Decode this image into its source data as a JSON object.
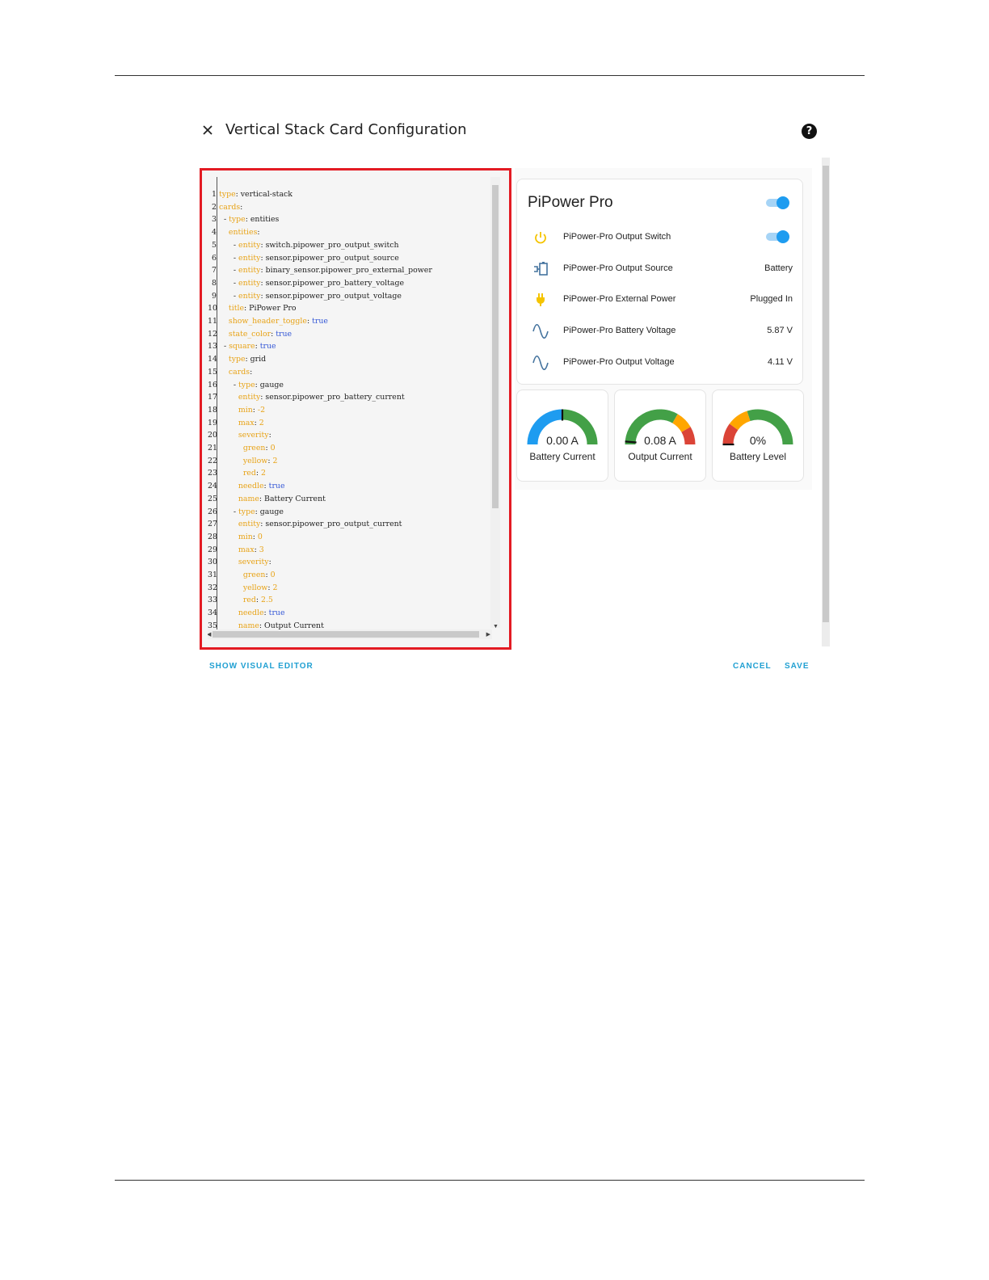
{
  "dialog": {
    "title": "Vertical Stack Card Configuration",
    "close_icon": "close-icon",
    "help_icon": "help-icon",
    "help_glyph": "?"
  },
  "editor": {
    "lines": [
      {
        "n": "1",
        "parts": [
          {
            "t": "type",
            "c": "k"
          },
          {
            "t": ": vertical-stack",
            "c": ""
          }
        ]
      },
      {
        "n": "2",
        "parts": [
          {
            "t": "cards",
            "c": "k"
          },
          {
            "t": ":",
            "c": ""
          }
        ]
      },
      {
        "n": "3",
        "parts": [
          {
            "t": "  - ",
            "c": ""
          },
          {
            "t": "type",
            "c": "k"
          },
          {
            "t": ": entities",
            "c": ""
          }
        ]
      },
      {
        "n": "4",
        "parts": [
          {
            "t": "    ",
            "c": ""
          },
          {
            "t": "entities",
            "c": "k"
          },
          {
            "t": ":",
            "c": ""
          }
        ]
      },
      {
        "n": "5",
        "parts": [
          {
            "t": "      - ",
            "c": ""
          },
          {
            "t": "entity",
            "c": "k"
          },
          {
            "t": ": switch.pipower_pro_output_switch",
            "c": ""
          }
        ]
      },
      {
        "n": "6",
        "parts": [
          {
            "t": "      - ",
            "c": ""
          },
          {
            "t": "entity",
            "c": "k"
          },
          {
            "t": ": sensor.pipower_pro_output_source",
            "c": ""
          }
        ]
      },
      {
        "n": "7",
        "parts": [
          {
            "t": "      - ",
            "c": ""
          },
          {
            "t": "entity",
            "c": "k"
          },
          {
            "t": ": binary_sensor.pipower_pro_external_power",
            "c": ""
          }
        ]
      },
      {
        "n": "8",
        "parts": [
          {
            "t": "      - ",
            "c": ""
          },
          {
            "t": "entity",
            "c": "k"
          },
          {
            "t": ": sensor.pipower_pro_battery_voltage",
            "c": ""
          }
        ]
      },
      {
        "n": "9",
        "parts": [
          {
            "t": "      - ",
            "c": ""
          },
          {
            "t": "entity",
            "c": "k"
          },
          {
            "t": ": sensor.pipower_pro_output_voltage",
            "c": ""
          }
        ]
      },
      {
        "n": "10",
        "parts": [
          {
            "t": "    ",
            "c": ""
          },
          {
            "t": "title",
            "c": "k"
          },
          {
            "t": ": PiPower Pro",
            "c": ""
          }
        ]
      },
      {
        "n": "11",
        "parts": [
          {
            "t": "    ",
            "c": ""
          },
          {
            "t": "show_header_toggle",
            "c": "k"
          },
          {
            "t": ": ",
            "c": ""
          },
          {
            "t": "true",
            "c": "b"
          }
        ]
      },
      {
        "n": "12",
        "parts": [
          {
            "t": "    ",
            "c": ""
          },
          {
            "t": "state_color",
            "c": "k"
          },
          {
            "t": ": ",
            "c": ""
          },
          {
            "t": "true",
            "c": "b"
          }
        ]
      },
      {
        "n": "13",
        "parts": [
          {
            "t": "  - ",
            "c": ""
          },
          {
            "t": "square",
            "c": "k"
          },
          {
            "t": ": ",
            "c": ""
          },
          {
            "t": "true",
            "c": "b"
          }
        ]
      },
      {
        "n": "14",
        "parts": [
          {
            "t": "    ",
            "c": ""
          },
          {
            "t": "type",
            "c": "k"
          },
          {
            "t": ": grid",
            "c": ""
          }
        ]
      },
      {
        "n": "15",
        "parts": [
          {
            "t": "    ",
            "c": ""
          },
          {
            "t": "cards",
            "c": "k"
          },
          {
            "t": ":",
            "c": ""
          }
        ]
      },
      {
        "n": "16",
        "parts": [
          {
            "t": "      - ",
            "c": ""
          },
          {
            "t": "type",
            "c": "k"
          },
          {
            "t": ": gauge",
            "c": ""
          }
        ]
      },
      {
        "n": "17",
        "parts": [
          {
            "t": "        ",
            "c": ""
          },
          {
            "t": "entity",
            "c": "k"
          },
          {
            "t": ": sensor.pipower_pro_battery_current",
            "c": ""
          }
        ]
      },
      {
        "n": "18",
        "parts": [
          {
            "t": "        ",
            "c": ""
          },
          {
            "t": "min",
            "c": "k"
          },
          {
            "t": ": ",
            "c": ""
          },
          {
            "t": "-2",
            "c": "k"
          }
        ]
      },
      {
        "n": "19",
        "parts": [
          {
            "t": "        ",
            "c": ""
          },
          {
            "t": "max",
            "c": "k"
          },
          {
            "t": ": ",
            "c": ""
          },
          {
            "t": "2",
            "c": "k"
          }
        ]
      },
      {
        "n": "20",
        "parts": [
          {
            "t": "        ",
            "c": ""
          },
          {
            "t": "severity",
            "c": "k"
          },
          {
            "t": ":",
            "c": ""
          }
        ]
      },
      {
        "n": "21",
        "parts": [
          {
            "t": "          ",
            "c": ""
          },
          {
            "t": "green",
            "c": "k"
          },
          {
            "t": ": ",
            "c": ""
          },
          {
            "t": "0",
            "c": "k"
          }
        ]
      },
      {
        "n": "22",
        "parts": [
          {
            "t": "          ",
            "c": ""
          },
          {
            "t": "yellow",
            "c": "k"
          },
          {
            "t": ": ",
            "c": ""
          },
          {
            "t": "2",
            "c": "k"
          }
        ]
      },
      {
        "n": "23",
        "parts": [
          {
            "t": "          ",
            "c": ""
          },
          {
            "t": "red",
            "c": "k"
          },
          {
            "t": ": ",
            "c": ""
          },
          {
            "t": "2",
            "c": "k"
          }
        ]
      },
      {
        "n": "24",
        "parts": [
          {
            "t": "        ",
            "c": ""
          },
          {
            "t": "needle",
            "c": "k"
          },
          {
            "t": ": ",
            "c": ""
          },
          {
            "t": "true",
            "c": "b"
          }
        ]
      },
      {
        "n": "25",
        "parts": [
          {
            "t": "        ",
            "c": ""
          },
          {
            "t": "name",
            "c": "k"
          },
          {
            "t": ": Battery Current",
            "c": ""
          }
        ]
      },
      {
        "n": "26",
        "parts": [
          {
            "t": "      - ",
            "c": ""
          },
          {
            "t": "type",
            "c": "k"
          },
          {
            "t": ": gauge",
            "c": ""
          }
        ]
      },
      {
        "n": "27",
        "parts": [
          {
            "t": "        ",
            "c": ""
          },
          {
            "t": "entity",
            "c": "k"
          },
          {
            "t": ": sensor.pipower_pro_output_current",
            "c": ""
          }
        ]
      },
      {
        "n": "28",
        "parts": [
          {
            "t": "        ",
            "c": ""
          },
          {
            "t": "min",
            "c": "k"
          },
          {
            "t": ": ",
            "c": ""
          },
          {
            "t": "0",
            "c": "k"
          }
        ]
      },
      {
        "n": "29",
        "parts": [
          {
            "t": "        ",
            "c": ""
          },
          {
            "t": "max",
            "c": "k"
          },
          {
            "t": ": ",
            "c": ""
          },
          {
            "t": "3",
            "c": "k"
          }
        ]
      },
      {
        "n": "30",
        "parts": [
          {
            "t": "        ",
            "c": ""
          },
          {
            "t": "severity",
            "c": "k"
          },
          {
            "t": ":",
            "c": ""
          }
        ]
      },
      {
        "n": "31",
        "parts": [
          {
            "t": "          ",
            "c": ""
          },
          {
            "t": "green",
            "c": "k"
          },
          {
            "t": ": ",
            "c": ""
          },
          {
            "t": "0",
            "c": "k"
          }
        ]
      },
      {
        "n": "32",
        "parts": [
          {
            "t": "          ",
            "c": ""
          },
          {
            "t": "yellow",
            "c": "k"
          },
          {
            "t": ": ",
            "c": ""
          },
          {
            "t": "2",
            "c": "k"
          }
        ]
      },
      {
        "n": "33",
        "parts": [
          {
            "t": "          ",
            "c": ""
          },
          {
            "t": "red",
            "c": "k"
          },
          {
            "t": ": ",
            "c": ""
          },
          {
            "t": "2.5",
            "c": "k"
          }
        ]
      },
      {
        "n": "34",
        "parts": [
          {
            "t": "        ",
            "c": ""
          },
          {
            "t": "needle",
            "c": "k"
          },
          {
            "t": ": ",
            "c": ""
          },
          {
            "t": "true",
            "c": "b"
          }
        ]
      },
      {
        "n": "35",
        "parts": [
          {
            "t": "        ",
            "c": ""
          },
          {
            "t": "name",
            "c": "k"
          },
          {
            "t": ": Output Current",
            "c": ""
          }
        ]
      }
    ]
  },
  "entities_card": {
    "title": "PiPower Pro",
    "header_toggle_on": true,
    "rows": [
      {
        "icon": "power-icon",
        "label": "PiPower-Pro Output Switch",
        "kind": "toggle",
        "value": ""
      },
      {
        "icon": "battery-plug-icon",
        "label": "PiPower-Pro Output Source",
        "kind": "text",
        "value": "Battery"
      },
      {
        "icon": "plug-icon",
        "label": "PiPower-Pro External Power",
        "kind": "text",
        "value": "Plugged In"
      },
      {
        "icon": "sine-wave-icon",
        "label": "PiPower-Pro Battery Voltage",
        "kind": "text",
        "value": "5.87 V"
      },
      {
        "icon": "sine-wave-icon",
        "label": "PiPower-Pro Output Voltage",
        "kind": "text",
        "value": "4.11 V"
      }
    ]
  },
  "gauges": [
    {
      "name": "Battery Current",
      "value_text": "0.00 A",
      "value": 0.0,
      "min": -2,
      "max": 2,
      "fill_color": "#1e9cf0",
      "needle": true,
      "segments": []
    },
    {
      "name": "Output Current",
      "value_text": "0.08 A",
      "value": 0.08,
      "min": 0,
      "max": 3,
      "needle": true,
      "segments": [
        {
          "from": 0,
          "to": 2,
          "color": "#43a047"
        },
        {
          "from": 2,
          "to": 2.5,
          "color": "#ffa600"
        },
        {
          "from": 2.5,
          "to": 3,
          "color": "#db4437"
        }
      ]
    },
    {
      "name": "Battery Level",
      "value_text": "0%",
      "value": 0,
      "min": 0,
      "max": 100,
      "needle": true,
      "segments": [
        {
          "from": 0,
          "to": 20,
          "color": "#db4437"
        },
        {
          "from": 20,
          "to": 40,
          "color": "#ffa600"
        },
        {
          "from": 40,
          "to": 100,
          "color": "#43a047"
        }
      ]
    }
  ],
  "actions": {
    "show_visual_editor": "SHOW VISUAL EDITOR",
    "cancel": "CANCEL",
    "save": "SAVE"
  },
  "colors": {
    "accent": "#21a0d2",
    "highlight_border": "#e31b23",
    "toggle_on": "#1e9cf0",
    "icon_yellow": "#f5c400",
    "icon_blue": "#44739e"
  }
}
